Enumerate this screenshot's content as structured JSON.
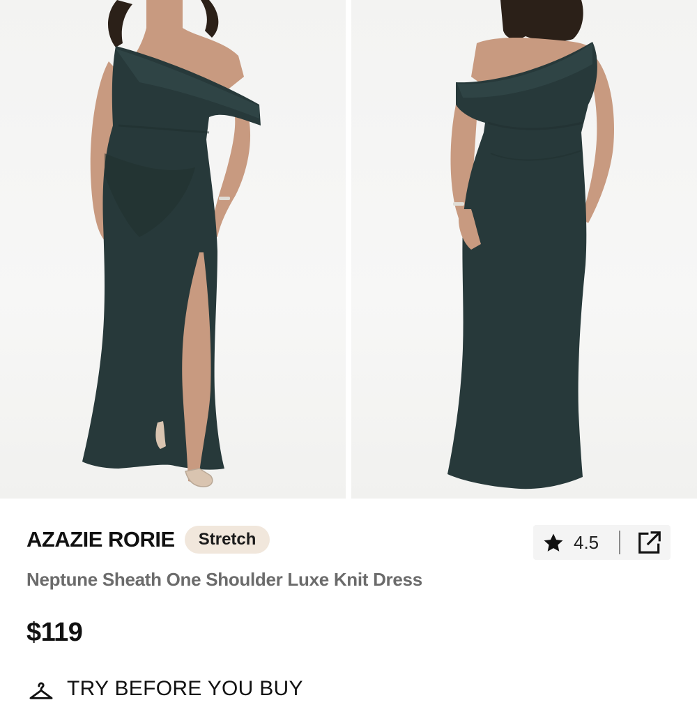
{
  "product": {
    "brand": "AZAZIE RORIE",
    "badge": "Stretch",
    "name": "Neptune Sheath One Shoulder Luxe Knit Dress",
    "price": "$119",
    "rating": "4.5",
    "try_before_label": "TRY BEFORE YOU BUY"
  },
  "gallery": {
    "images": [
      {
        "icon": "dress-front-photo"
      },
      {
        "icon": "dress-back-photo"
      }
    ],
    "dress_color": "#27393a"
  },
  "icons": {
    "rating": "star-icon",
    "share": "share-external-icon",
    "try_before": "hanger-icon"
  },
  "colors": {
    "badge_bg": "#f1e7dc",
    "rating_bg": "#f4f4f4",
    "name_text": "#6b6b6b"
  }
}
